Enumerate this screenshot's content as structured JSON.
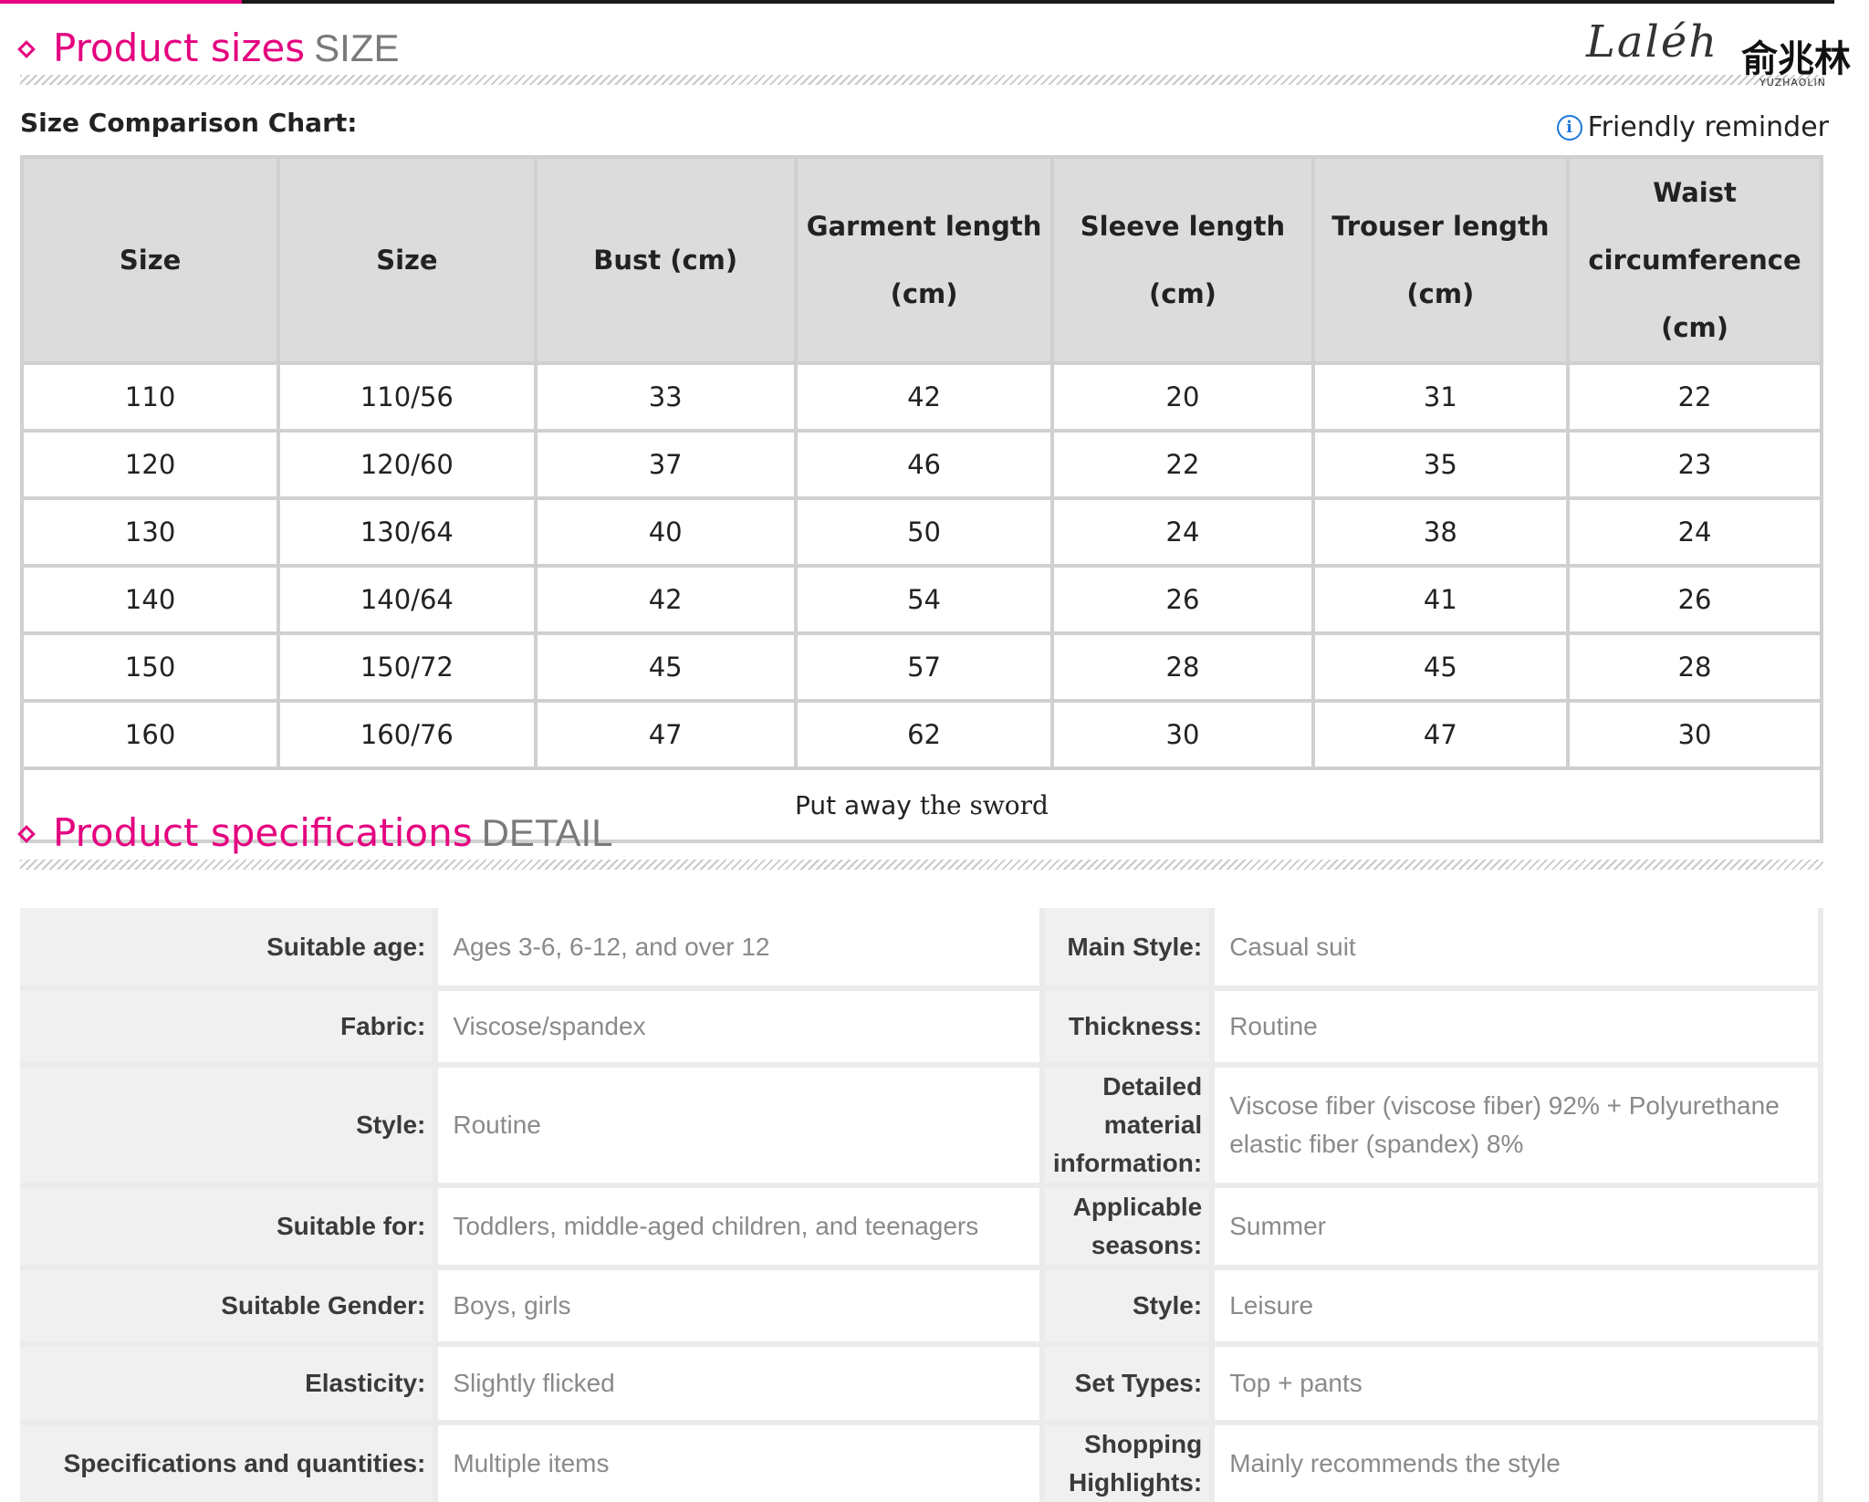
{
  "sizes_section": {
    "title": "Product sizes",
    "subtitle": "SIZE"
  },
  "logo": {
    "script": "Laléh",
    "chinese": "俞兆林",
    "english": "YUZHAOLIN"
  },
  "chart_label": "Size Comparison Chart:",
  "reminder": {
    "icon": "info-icon",
    "label": "Friendly reminder"
  },
  "size_table": {
    "headers": [
      "Size",
      "Size",
      "Bust (cm)",
      "Garment length (cm)",
      "Sleeve length (cm)",
      "Trouser length (cm)",
      "Waist circumference (cm)"
    ],
    "rows": [
      [
        "110",
        "110/56",
        "33",
        "42",
        "20",
        "31",
        "22"
      ],
      [
        "120",
        "120/60",
        "37",
        "46",
        "22",
        "35",
        "23"
      ],
      [
        "130",
        "130/64",
        "40",
        "50",
        "24",
        "38",
        "24"
      ],
      [
        "140",
        "140/64",
        "42",
        "54",
        "26",
        "41",
        "26"
      ],
      [
        "150",
        "150/72",
        "45",
        "57",
        "28",
        "45",
        "28"
      ],
      [
        "160",
        "160/76",
        "47",
        "62",
        "30",
        "47",
        "30"
      ]
    ],
    "note": {
      "part1": "Put away",
      "part2": "the sword"
    }
  },
  "specs_section": {
    "title": "Product specifications",
    "subtitle": "DETAIL"
  },
  "specs": [
    {
      "k1": "Suitable age:",
      "v1": "Ages 3-6, 6-12, and over 12",
      "k2": "Main Style:",
      "v2": "Casual suit"
    },
    {
      "k1": "Fabric:",
      "v1": "Viscose/spandex",
      "k2": "Thickness:",
      "v2": "Routine"
    },
    {
      "k1": "Style:",
      "v1": "Routine",
      "k2": "Detailed material information:",
      "v2": "Viscose fiber (viscose fiber) 92% + Polyurethane elastic fiber (spandex) 8%"
    },
    {
      "k1": "Suitable for:",
      "v1": "Toddlers, middle-aged children, and teenagers",
      "k2": "Applicable seasons:",
      "v2": "Summer"
    },
    {
      "k1": "Suitable Gender:",
      "v1": "Boys, girls",
      "k2": "Style:",
      "v2": "Leisure"
    },
    {
      "k1": "Elasticity:",
      "v1": "Slightly flicked",
      "k2": "Set Types:",
      "v2": "Top + pants"
    },
    {
      "k1": "Specifications and quantities:",
      "v1": "Multiple items",
      "k2": "Shopping Highlights:",
      "v2": "Mainly recommends the style"
    }
  ],
  "colors": {
    "accent": "#e4007f",
    "header_bg": "#dcdcdc",
    "info_blue": "#1e78d8"
  }
}
